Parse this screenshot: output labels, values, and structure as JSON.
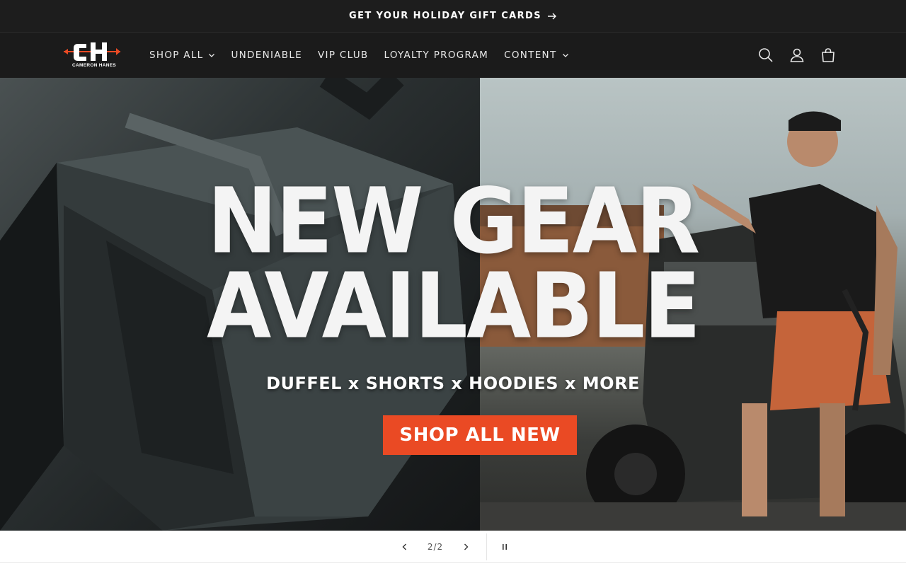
{
  "announcement": {
    "text": "GET YOUR HOLIDAY GIFT CARDS"
  },
  "brand": {
    "logo_letters": "CH",
    "logo_name": "CAMERON HANES",
    "accent": "#ea4a24"
  },
  "nav": {
    "items": [
      {
        "label": "SHOP ALL",
        "has_dropdown": true
      },
      {
        "label": "UNDENIABLE",
        "has_dropdown": false
      },
      {
        "label": "VIP CLUB",
        "has_dropdown": false
      },
      {
        "label": "LOYALTY PROGRAM",
        "has_dropdown": false
      },
      {
        "label": "CONTENT",
        "has_dropdown": true
      }
    ]
  },
  "header_icons": [
    "search-icon",
    "account-icon",
    "cart-icon"
  ],
  "hero": {
    "headline_line1": "NEW GEAR",
    "headline_line2": "AVAILABLE",
    "subline": "DUFFEL x SHORTS x HOODIES x MORE",
    "cta_label": "SHOP ALL NEW"
  },
  "slideshow": {
    "counter": "2/2",
    "current": 2,
    "total": 2
  }
}
